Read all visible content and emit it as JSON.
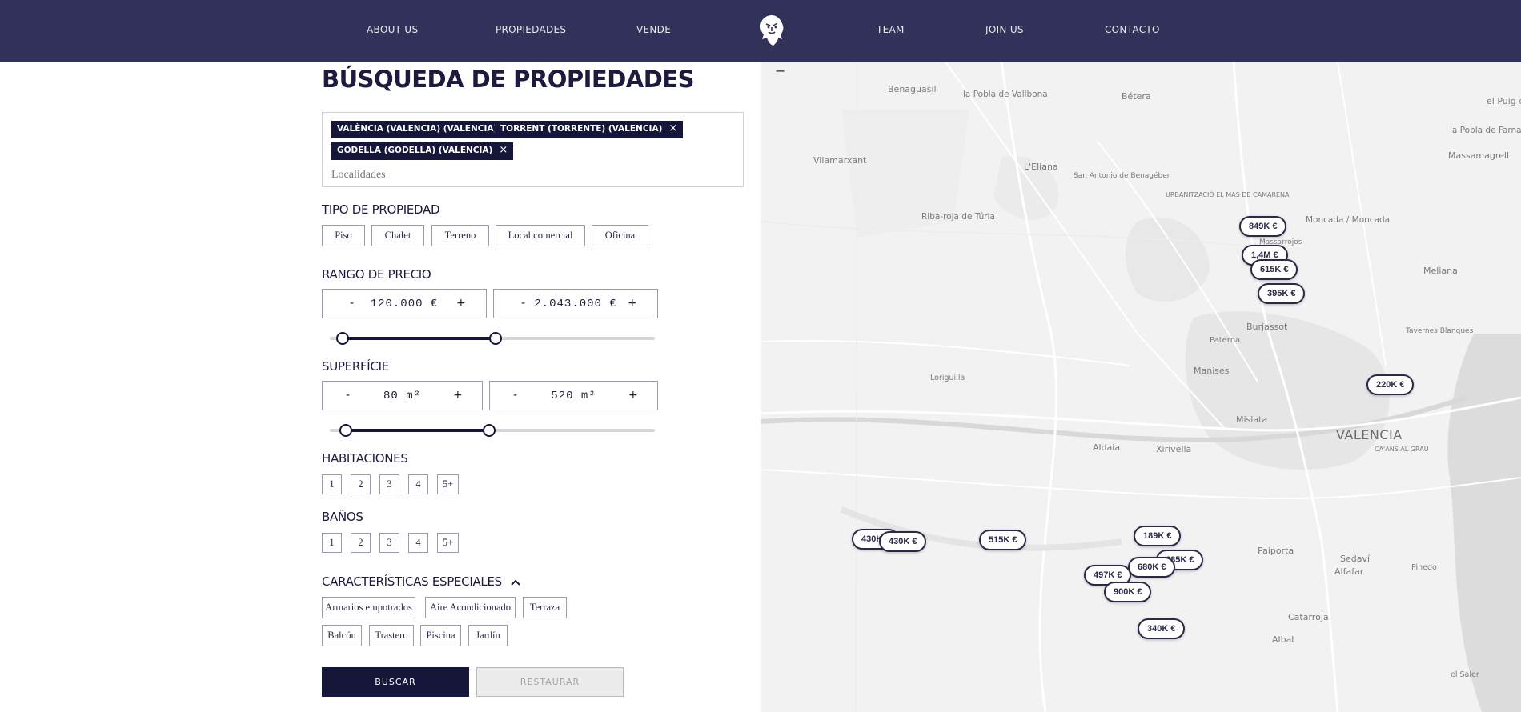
{
  "nav": {
    "items": [
      "ABOUT US",
      "PROPIEDADES",
      "VENDE",
      "TEAM",
      "JOIN US",
      "CONTACTO"
    ],
    "logo_icon": "lion-head-icon"
  },
  "search": {
    "title": "BÚSQUEDA DE PROPIEDADES",
    "chips": [
      "VALÈNCIA (VALENCIA) (VALENCIA)",
      "TORRENT (TORRENTE) (VALENCIA)",
      "GODELLA (GODELLA) (VALENCIA)"
    ],
    "chip_remove": "×",
    "placeholder": "Localidades"
  },
  "tipo": {
    "label": "TIPO DE PROPIEDAD",
    "options": [
      "Piso",
      "Chalet",
      "Terreno",
      "Local comercial",
      "Oficina"
    ]
  },
  "precio": {
    "label": "RANGO DE PRECIO",
    "min": "120.000 €",
    "max": "2.043.000 €",
    "minus": "-",
    "plus": "+",
    "slider_min_fraction": 0.04,
    "slider_max_fraction": 0.51
  },
  "superficie": {
    "label": "SUPERFÍCIE",
    "min": "80 m²",
    "max": "520 m²",
    "slider_min_fraction": 0.05,
    "slider_max_fraction": 0.49
  },
  "habitaciones": {
    "label": "HABITACIONES",
    "options": [
      "1",
      "2",
      "3",
      "4",
      "5+"
    ]
  },
  "banos": {
    "label": "BAÑOS",
    "options": [
      "1",
      "2",
      "3",
      "4",
      "5+"
    ]
  },
  "caracteristicas": {
    "label": "CARACTERÍSTICAS ESPECIALES",
    "toggle_icon": "chevron-up-icon",
    "options": [
      "Armarios empotrados",
      "Aire Acondicionado",
      "Terraza",
      "Balcón",
      "Trastero",
      "Piscina",
      "Jardín"
    ]
  },
  "actions": {
    "search": "BUSCAR",
    "reset": "RESTAURAR"
  },
  "map": {
    "zoom_out": "−",
    "places": [
      "Benaguasil",
      "la Pobla de Vallbona",
      "Bétera",
      "el Puig de",
      "la Pobla de Farnals",
      "Massamagrell",
      "Vilamarxant",
      "L'Eliana",
      "San Antonio de Benagéber",
      "URBANITZACIÓ EL MAS DE CAMARENA",
      "Riba-roja de Túria",
      "Moncada / Moncada",
      "Massarrojos",
      "Meliana",
      "Burjassot",
      "Paterna",
      "Tavernes Blanques",
      "Manises",
      "Loriguilla",
      "Mislata",
      "VALENCIA",
      "Aldaia",
      "Xirivella",
      "CA'ANS AL GRAU",
      "Paiporta",
      "Sedaví",
      "Alfafar",
      "Pinedo",
      "Catarroja",
      "Albal",
      "el Saler"
    ],
    "prices": [
      "849K €",
      "1,4M €",
      "615K €",
      "395K €",
      "220K €",
      "430K €",
      "430K €",
      "515K €",
      "189K €",
      "685K €",
      "680K €",
      "497K €",
      "900K €",
      "340K €"
    ],
    "colors": {
      "nav": "#31315a",
      "accent": "#16163a"
    }
  }
}
